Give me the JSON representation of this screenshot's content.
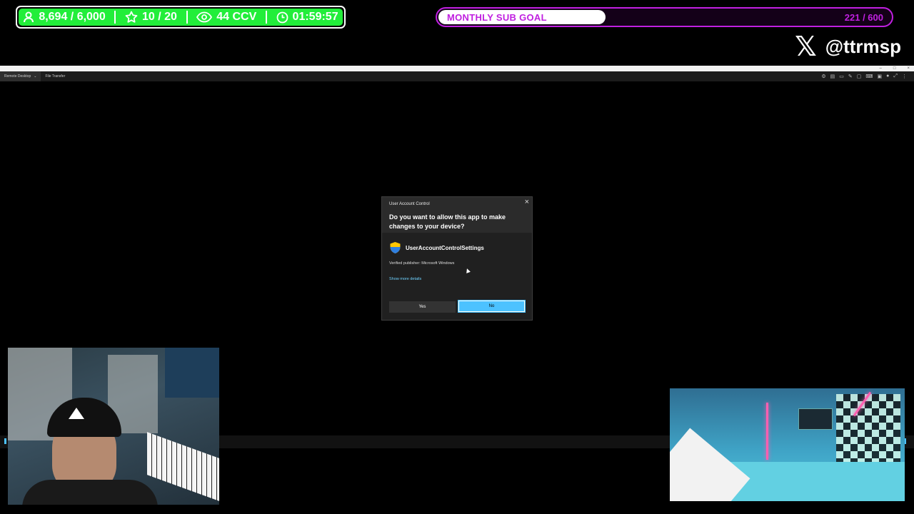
{
  "stats": {
    "followers": "8,694 / 6,000",
    "subs": "10 / 20",
    "viewers": "44 CCV",
    "uptime": "01:59:57"
  },
  "goal": {
    "label": "MONTHLY SUB GOAL",
    "count": "221 / 600",
    "progress": 0.368,
    "accent": "#c020e0"
  },
  "social": {
    "icon": "x-logo-icon",
    "handle": "@ttrmsp"
  },
  "remote_desktop": {
    "tabs": [
      "Remote Desktop",
      "File Transfer"
    ]
  },
  "uac": {
    "app_title": "User Account Control",
    "question": "Do you want to allow this app to make changes to your device?",
    "app_name": "UserAccountControlSettings",
    "publisher": "Verified publisher: Microsoft Windows",
    "details_link": "Show more details",
    "yes_label": "Yes",
    "no_label": "No"
  },
  "colors": {
    "stats_bg": "#22ee3a",
    "uac_accent": "#4cc2ff"
  }
}
